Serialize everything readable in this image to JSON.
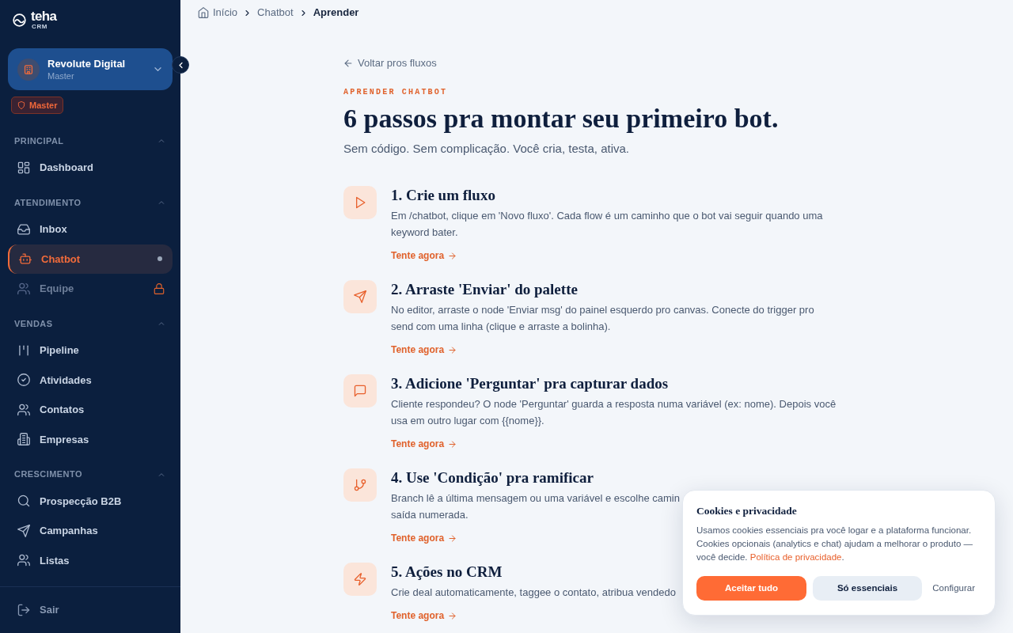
{
  "sidebar": {
    "logo": {
      "name": "teha",
      "tagline": "CRM"
    },
    "workspace": {
      "name": "Revolute Digital",
      "role": "Master"
    },
    "role_badge": "Master",
    "sections": [
      {
        "title": "PRINCIPAL",
        "expanded": true,
        "items": [
          {
            "label": "Dashboard",
            "selected": false,
            "disabled": false
          }
        ]
      },
      {
        "title": "ATENDIMENTO",
        "expanded": true,
        "items": [
          {
            "label": "Inbox",
            "selected": false,
            "disabled": false
          },
          {
            "label": "Chatbot",
            "selected": true,
            "disabled": false
          },
          {
            "label": "Equipe",
            "selected": false,
            "disabled": true
          }
        ]
      },
      {
        "title": "VENDAS",
        "expanded": true,
        "items": [
          {
            "label": "Pipeline",
            "selected": false,
            "disabled": false
          },
          {
            "label": "Atividades",
            "selected": false,
            "disabled": false
          },
          {
            "label": "Contatos",
            "selected": false,
            "disabled": false
          },
          {
            "label": "Empresas",
            "selected": false,
            "disabled": false
          }
        ]
      },
      {
        "title": "CRESCIMENTO",
        "expanded": true,
        "items": [
          {
            "label": "Prospecção B2B",
            "selected": false,
            "disabled": false
          },
          {
            "label": "Campanhas",
            "selected": false,
            "disabled": false
          },
          {
            "label": "Listas",
            "selected": false,
            "disabled": false
          }
        ]
      }
    ],
    "logout": "Sair"
  },
  "breadcrumb": [
    {
      "label": "Início",
      "current": false
    },
    {
      "label": "Chatbot",
      "current": false
    },
    {
      "label": "Aprender",
      "current": true
    }
  ],
  "back_link": "Voltar pros fluxos",
  "eyebrow": "APRENDER CHATBOT",
  "title": "6 passos pra montar seu primeiro bot.",
  "subtitle": "Sem código. Sem complicação. Você cria, testa, ativa.",
  "steps": [
    {
      "title": "1. Crie um fluxo",
      "description_lines": [
        "Em /chatbot, clique em 'Novo fluxo'. Cada flow é um caminho que o bot vai seguir quando uma",
        "keyword bater."
      ],
      "link": "Tente agora"
    },
    {
      "title": "2. Arraste 'Enviar' do palette",
      "description_lines": [
        "No editor, arraste o node 'Enviar msg' do painel esquerdo pro canvas. Conecte do trigger pro",
        "send com uma linha (clique e arraste a bolinha)."
      ],
      "link": "Tente agora"
    },
    {
      "title": "3. Adicione 'Perguntar' pra capturar dados",
      "description_lines": [
        "Cliente respondeu? O node 'Perguntar' guarda a resposta numa variável (ex: nome). Depois você",
        "usa em outro lugar com {{nome}}."
      ],
      "link": "Tente agora"
    },
    {
      "title": "4. Use 'Condição' pra ramificar",
      "description_lines": [
        "Branch lê a última mensagem ou uma variável e escolhe camin",
        "saída numerada."
      ],
      "link": "Tente agora"
    },
    {
      "title": "5. Ações no CRM",
      "description_lines": [
        "Crie deal automaticamente, taggee o contato, atribua vendedo"
      ],
      "link": "Tente agora"
    }
  ],
  "cookie_banner": {
    "title": "Cookies e privacidade",
    "lines": [
      "Usamos cookies essenciais pra você logar e a plataforma funcionar.",
      "Cookies opcionais (analytics e chat) ajudam a melhorar o produto —",
      "você decide."
    ],
    "link": "Política de privacidade",
    "link_suffix": ".",
    "buttons": [
      {
        "label": "Aceitar tudo",
        "kind": "primary"
      },
      {
        "label": "Só essenciais",
        "kind": "secondary"
      },
      {
        "label": "Configurar",
        "kind": "text"
      }
    ]
  }
}
